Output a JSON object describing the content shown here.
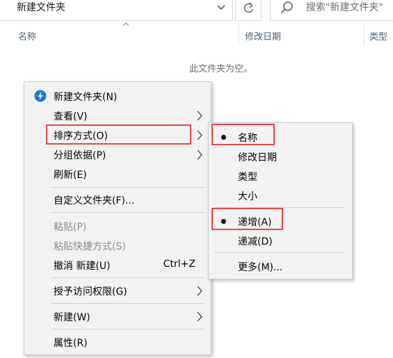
{
  "address_bar": {
    "path": "新建文件夹"
  },
  "search": {
    "placeholder": "搜索\"新建文件夹\""
  },
  "columns": [
    {
      "label": "名称"
    },
    {
      "label": "修改日期"
    },
    {
      "label": "类型"
    }
  ],
  "empty_message": "此文件夹为空。",
  "context_menu": {
    "items": [
      {
        "label": "新建文件夹(N)",
        "icon": "lightning-icon"
      },
      {
        "label": "查看(V)",
        "submenu": true
      },
      {
        "label": "排序方式(O)",
        "submenu": true,
        "highlighted": true
      },
      {
        "label": "分组依据(P)",
        "submenu": true
      },
      {
        "label": "刷新(E)"
      },
      {
        "label": "自定义文件夹(F)..."
      },
      {
        "label": "粘贴(P)",
        "disabled": true
      },
      {
        "label": "粘贴快捷方式(S)",
        "disabled": true
      },
      {
        "label": "撤消 新建(U)",
        "shortcut": "Ctrl+Z"
      },
      {
        "label": "授予访问权限(G)",
        "submenu": true
      },
      {
        "label": "新建(W)",
        "submenu": true
      },
      {
        "label": "属性(R)"
      }
    ]
  },
  "sort_submenu": {
    "items": [
      {
        "label": "名称",
        "checked": true,
        "highlighted": true
      },
      {
        "label": "修改日期"
      },
      {
        "label": "类型"
      },
      {
        "label": "大小"
      },
      {
        "label": "递增(A)",
        "checked": true,
        "highlighted": true
      },
      {
        "label": "递减(D)"
      },
      {
        "label": "更多(M)..."
      }
    ]
  },
  "colors": {
    "highlight_border": "#e84545",
    "menu_background": "#f2f2f2",
    "column_header_text": "#4c607a",
    "disabled_text": "#8a8a8a",
    "lightning_icon": "#1e78d7"
  }
}
